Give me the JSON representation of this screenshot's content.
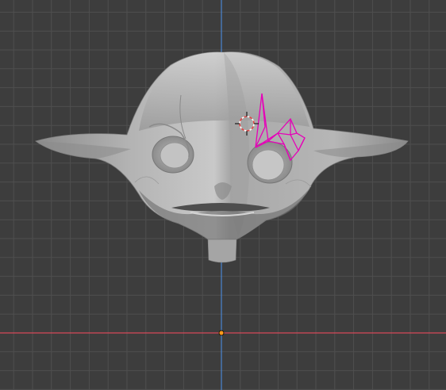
{
  "viewport": {
    "view": "3d-viewport",
    "colors": {
      "background": "#3d3d3d",
      "grid_minor": "#474747",
      "grid_major": "#4f4f4f",
      "x_axis": "#d64a5a",
      "z_axis": "#4a86d2",
      "mesh_light": "#c8c8c8",
      "mesh_mid": "#a9a9a9",
      "mesh_dark": "#5e5e5e",
      "selection": "#e600b8",
      "cursor_red": "#e24646",
      "origin_dot": "#ff9a1a"
    },
    "objects": [
      {
        "name": "head-mesh",
        "selected": false
      },
      {
        "name": "eyebrow-mesh",
        "selected": true
      }
    ],
    "icons": [
      "3d-cursor-icon",
      "world-origin-icon"
    ]
  }
}
